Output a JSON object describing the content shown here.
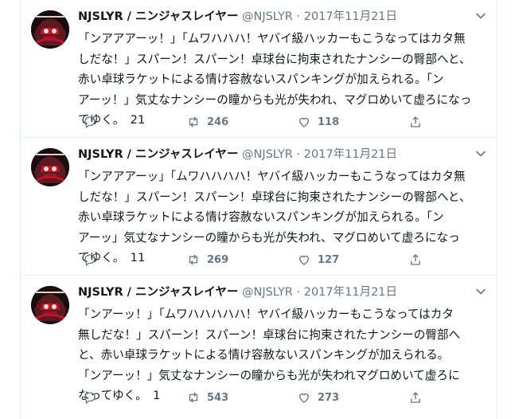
{
  "tweets": [
    {
      "author_name": "NJSLYR / ニンジャスレイヤー",
      "handle": "@NJSLYR",
      "separator": "·",
      "date": "2017年11月21日",
      "lines": [
        "「ンアアアーッ！」「ムワハハハ！ヤバイ級ハッカーもこうなってはカタ無",
        "しだな！」スパーン！スパーン！卓球台に拘束されたナンシーの臀部へと、",
        "赤い卓球ラケットによる情け容赦ないスパンキングが加えられる。「ン",
        "アーッ！」気丈なナンシーの瞳からも光が失われ、マグロめいて虚ろになっ",
        "てゆく。　21"
      ],
      "replies": "",
      "retweets": "246",
      "likes": "118",
      "avatar_text": "NINJA SLAYER"
    },
    {
      "author_name": "NJSLYR / ニンジャスレイヤー",
      "handle": "@NJSLYR",
      "separator": "·",
      "date": "2017年11月21日",
      "lines": [
        "「ンアアアーッ」「ムワハハハハ！ヤバイ級ハッカーもこうなってはカタ無",
        "しだな！」スパーン！スパーン！卓球台に拘束されたナンシーの臀部へと、",
        "赤い卓球ラケットによる情け容赦ないスパンキングが加えられる。「ン",
        "アーッ」気丈なナンシーの瞳からも光が失われ、マグロめいて虚ろになっ",
        "てゆく。　11"
      ],
      "replies": "",
      "retweets": "269",
      "likes": "127",
      "avatar_text": "NINJA SLAYER"
    },
    {
      "author_name": "NJSLYR / ニンジャスレイヤー",
      "handle": "@NJSLYR",
      "separator": "·",
      "date": "2017年11月21日",
      "lines": [
        "「ンアーッ！」「ムワハハハハハ！ヤバイ級ハッカーもこうなってはカタ",
        "無しだな！」スパーン！スパーン！卓球台に拘束されたナンシーの臀部へ",
        "と、赤い卓球ラケットによる情け容赦ないスパンキングが加えられる。",
        "「ンアーッ！」気丈なナンシーの瞳からも光が失われマグロめいて虚ろに",
        "なってゆく。　1"
      ],
      "replies": "",
      "retweets": "543",
      "likes": "273",
      "avatar_text": "NINJA SLAYER"
    }
  ],
  "colors": {
    "text": "#14171a",
    "secondary": "#657786",
    "border": "#e6ecf0",
    "avatar_red": "#c8102e"
  },
  "icons": {
    "reply": "reply-icon",
    "retweet": "retweet-icon",
    "like": "heart-icon",
    "share": "share-icon",
    "menu": "chevron-down-icon"
  }
}
